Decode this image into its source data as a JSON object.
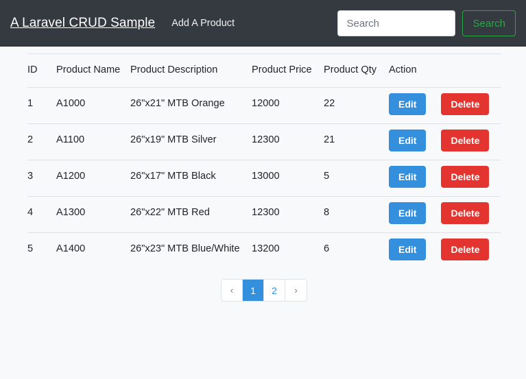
{
  "navbar": {
    "brand": "A Laravel CRUD Sample",
    "links": [
      {
        "label": "Add A Product"
      }
    ],
    "search": {
      "placeholder": "Search",
      "value": "",
      "button_label": "Search"
    },
    "bg_color": "#343a40",
    "search_button_color": "#28a745"
  },
  "table": {
    "headers": {
      "id": "ID",
      "name": "Product Name",
      "description": "Product Description",
      "price": "Product Price",
      "qty": "Product Qty",
      "action": "Action"
    },
    "action_labels": {
      "edit": "Edit",
      "delete": "Delete"
    },
    "action_colors": {
      "edit": "#3490dc",
      "delete": "#e3342f"
    },
    "rows": [
      {
        "id": "1",
        "name": "A1000",
        "description": "26\"x21\" MTB Orange",
        "price": "12000",
        "qty": "22"
      },
      {
        "id": "2",
        "name": "A1100",
        "description": "26\"x19\" MTB Silver",
        "price": "12300",
        "qty": "21"
      },
      {
        "id": "3",
        "name": "A1200",
        "description": "26\"x17\" MTB Black",
        "price": "13000",
        "qty": "5"
      },
      {
        "id": "4",
        "name": "A1300",
        "description": "26\"x22\" MTB Red",
        "price": "12300",
        "qty": "8"
      },
      {
        "id": "5",
        "name": "A1400",
        "description": "26\"x23\" MTB Blue/White",
        "price": "13200",
        "qty": "6"
      }
    ]
  },
  "pagination": {
    "prev_label": "‹",
    "next_label": "›",
    "pages": [
      {
        "label": "1",
        "active": true
      },
      {
        "label": "2",
        "active": false
      }
    ],
    "active_color": "#3490dc"
  }
}
